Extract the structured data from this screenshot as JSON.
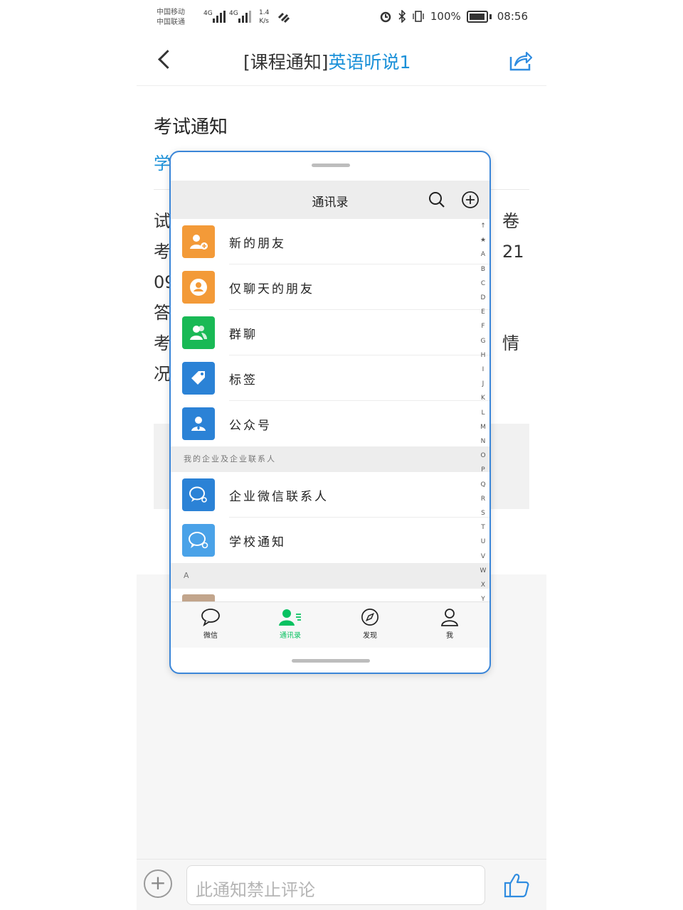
{
  "status_bar": {
    "carrier1": "中国移动",
    "carrier2": "中国联通",
    "net1": "4G",
    "net2": "4G",
    "speed": "1.4",
    "speed_unit": "K/s",
    "battery": "100%",
    "time": "08:56"
  },
  "header": {
    "tag": "[课程通知]",
    "course": "英语听说1"
  },
  "article": {
    "title": "考试通知",
    "meta_fragment": "学",
    "lines": [
      {
        "left": "试",
        "right": "卷"
      },
      {
        "left": "考",
        "right": "21"
      },
      {
        "left": "09",
        "right": ""
      },
      {
        "left": "答",
        "right": ""
      },
      {
        "left": "考",
        "right": "情"
      },
      {
        "left": "况",
        "right": ""
      }
    ]
  },
  "comment_bar": {
    "placeholder": "此通知禁止评论"
  },
  "overlay": {
    "title": "通讯录",
    "items": [
      {
        "label": "新的朋友",
        "color": "#f39a38"
      },
      {
        "label": "仅聊天的朋友",
        "color": "#f39a38"
      },
      {
        "label": "群聊",
        "color": "#19b955"
      },
      {
        "label": "标签",
        "color": "#2b82d6"
      },
      {
        "label": "公众号",
        "color": "#2b82d6"
      }
    ],
    "section_enterprise": "我的企业及企业联系人",
    "enterprise_items": [
      {
        "label": "企业微信联系人",
        "color": "#2b82d6"
      },
      {
        "label": "学校通知",
        "color": "#4aa2e8"
      }
    ],
    "section_a": "A",
    "index_letters": [
      "↑",
      "★",
      "A",
      "B",
      "C",
      "D",
      "E",
      "F",
      "G",
      "H",
      "I",
      "J",
      "K",
      "L",
      "M",
      "N",
      "O",
      "P",
      "Q",
      "R",
      "S",
      "T",
      "U",
      "V",
      "W",
      "X",
      "Y"
    ],
    "tabs": [
      {
        "label": "微信",
        "icon": "chat-bubble-icon"
      },
      {
        "label": "通讯录",
        "icon": "contacts-icon",
        "active": true
      },
      {
        "label": "发现",
        "icon": "compass-icon"
      },
      {
        "label": "我",
        "icon": "person-icon"
      }
    ],
    "accent": "#07c160"
  }
}
